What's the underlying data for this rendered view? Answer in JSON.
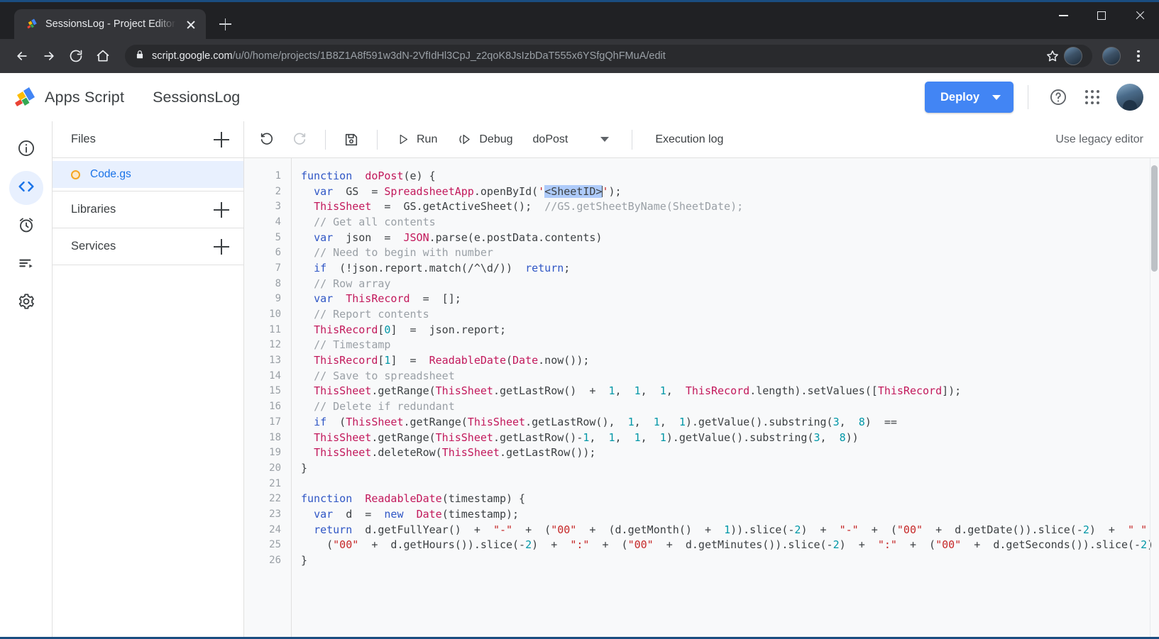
{
  "browser": {
    "tab": {
      "title": "SessionsLog - Project Editor - Ap",
      "favicon": "apps-script-favicon"
    },
    "new_tab_label": "+",
    "url_domain": "script.google.com",
    "url_path": "/u/0/home/projects/1B8Z1A8f591w3dN-2VfIdHl3CpJ_z2qoK8JsIzbDaT555x6YSfgQhFMuA/edit",
    "window_controls": {
      "minimize": "minimize-icon",
      "maximize": "maximize-icon",
      "close": "close-icon"
    }
  },
  "appbar": {
    "brand": "Apps Script",
    "project_name": "SessionsLog",
    "deploy_label": "Deploy",
    "help_icon": "help-icon",
    "apps_icon": "apps-grid-icon",
    "avatar": "user-avatar"
  },
  "rail": {
    "items": [
      {
        "name": "overview",
        "icon": "info-circle-icon",
        "active": false
      },
      {
        "name": "editor",
        "icon": "code-brackets-icon",
        "active": true
      },
      {
        "name": "triggers",
        "icon": "alarm-clock-icon",
        "active": false
      },
      {
        "name": "executions",
        "icon": "executions-list-icon",
        "active": false
      },
      {
        "name": "settings",
        "icon": "gear-icon",
        "active": false
      }
    ]
  },
  "files_panel": {
    "files_header": "Files",
    "libraries_header": "Libraries",
    "services_header": "Services",
    "files": [
      {
        "name": "Code.gs",
        "selected": true,
        "status_dot": "unsaved-orange"
      }
    ]
  },
  "editor_toolbar": {
    "undo": "undo-icon",
    "redo": "redo-icon",
    "save": "save-icon",
    "run_label": "Run",
    "debug_label": "Debug",
    "function_selected": "doPost",
    "execution_log_label": "Execution log",
    "legacy_editor_label": "Use legacy editor"
  },
  "code": {
    "selection_text": "<SheetID>",
    "lines": [
      {
        "n": 1,
        "tokens": [
          [
            "kw",
            "function"
          ],
          [
            "",
            "  "
          ],
          [
            "id",
            "doPost"
          ],
          [
            "",
            "(e) {"
          ]
        ]
      },
      {
        "n": 2,
        "tokens": [
          [
            "",
            "  "
          ],
          [
            "kw",
            "var"
          ],
          [
            "",
            "  GS  = "
          ],
          [
            "id",
            "SpreadsheetApp"
          ],
          [
            "",
            ".openById("
          ],
          [
            "str",
            "'"
          ],
          [
            "sel",
            "<SheetID>"
          ],
          [
            "cursor",
            ""
          ],
          [
            "str",
            "'"
          ],
          [
            "",
            ");"
          ]
        ]
      },
      {
        "n": 3,
        "tokens": [
          [
            "",
            "  "
          ],
          [
            "id",
            "ThisSheet"
          ],
          [
            "",
            "  =  GS"
          ],
          [
            "",
            ".getActiveSheet();  "
          ],
          [
            "cmt",
            "//GS.getSheetByName(SheetDate);"
          ]
        ]
      },
      {
        "n": 4,
        "tokens": [
          [
            "",
            "  "
          ],
          [
            "cmt",
            "// Get all contents"
          ]
        ]
      },
      {
        "n": 5,
        "tokens": [
          [
            "",
            "  "
          ],
          [
            "kw",
            "var"
          ],
          [
            "",
            "  json  =  "
          ],
          [
            "id",
            "JSON"
          ],
          [
            "",
            ".parse(e.postData.contents)"
          ]
        ]
      },
      {
        "n": 6,
        "tokens": [
          [
            "",
            "  "
          ],
          [
            "cmt",
            "// Need to begin with number"
          ]
        ]
      },
      {
        "n": 7,
        "tokens": [
          [
            "",
            "  "
          ],
          [
            "kw",
            "if"
          ],
          [
            "",
            "  (!json.report.match(/^\\d/))  "
          ],
          [
            "kw",
            "return"
          ],
          [
            "",
            ";"
          ]
        ]
      },
      {
        "n": 8,
        "tokens": [
          [
            "",
            "  "
          ],
          [
            "cmt",
            "// Row array"
          ]
        ]
      },
      {
        "n": 9,
        "tokens": [
          [
            "",
            "  "
          ],
          [
            "kw",
            "var"
          ],
          [
            "",
            "  "
          ],
          [
            "id",
            "ThisRecord"
          ],
          [
            "",
            "  =  [];"
          ]
        ]
      },
      {
        "n": 10,
        "tokens": [
          [
            "",
            "  "
          ],
          [
            "cmt",
            "// Report contents"
          ]
        ]
      },
      {
        "n": 11,
        "tokens": [
          [
            "",
            "  "
          ],
          [
            "id",
            "ThisRecord"
          ],
          [
            "",
            "["
          ],
          [
            "num",
            "0"
          ],
          [
            "",
            "]  =  json.report;"
          ]
        ]
      },
      {
        "n": 12,
        "tokens": [
          [
            "",
            "  "
          ],
          [
            "cmt",
            "// Timestamp"
          ]
        ]
      },
      {
        "n": 13,
        "tokens": [
          [
            "",
            "  "
          ],
          [
            "id",
            "ThisRecord"
          ],
          [
            "",
            "["
          ],
          [
            "num",
            "1"
          ],
          [
            "",
            "]  =  "
          ],
          [
            "id",
            "ReadableDate"
          ],
          [
            "",
            "("
          ],
          [
            "id",
            "Date"
          ],
          [
            "",
            ".now());"
          ]
        ]
      },
      {
        "n": 14,
        "tokens": [
          [
            "",
            "  "
          ],
          [
            "cmt",
            "// Save to spreadsheet"
          ]
        ]
      },
      {
        "n": 15,
        "tokens": [
          [
            "",
            "  "
          ],
          [
            "id",
            "ThisSheet"
          ],
          [
            "",
            ".getRange("
          ],
          [
            "id",
            "ThisSheet"
          ],
          [
            "",
            ".getLastRow()  +  "
          ],
          [
            "num",
            "1"
          ],
          [
            "",
            ",  "
          ],
          [
            "num",
            "1"
          ],
          [
            "",
            ",  "
          ],
          [
            "num",
            "1"
          ],
          [
            "",
            ",  "
          ],
          [
            "id",
            "ThisRecord"
          ],
          [
            "",
            ".length).setValues(["
          ],
          [
            "id",
            "ThisRecord"
          ],
          [
            "",
            "]);"
          ]
        ]
      },
      {
        "n": 16,
        "tokens": [
          [
            "",
            "  "
          ],
          [
            "cmt",
            "// Delete if redundant"
          ]
        ]
      },
      {
        "n": 17,
        "tokens": [
          [
            "",
            "  "
          ],
          [
            "kw",
            "if"
          ],
          [
            "",
            "  ("
          ],
          [
            "id",
            "ThisSheet"
          ],
          [
            "",
            ".getRange("
          ],
          [
            "id",
            "ThisSheet"
          ],
          [
            "",
            ".getLastRow(),  "
          ],
          [
            "num",
            "1"
          ],
          [
            "",
            ",  "
          ],
          [
            "num",
            "1"
          ],
          [
            "",
            ",  "
          ],
          [
            "num",
            "1"
          ],
          [
            "",
            ").getValue().substring("
          ],
          [
            "num",
            "3"
          ],
          [
            "",
            ",  "
          ],
          [
            "num",
            "8"
          ],
          [
            "",
            ")  =="
          ]
        ]
      },
      {
        "n": 18,
        "tokens": [
          [
            "",
            "  "
          ],
          [
            "id",
            "ThisSheet"
          ],
          [
            "",
            ".getRange("
          ],
          [
            "id",
            "ThisSheet"
          ],
          [
            "",
            ".getLastRow()-"
          ],
          [
            "num",
            "1"
          ],
          [
            "",
            ",  "
          ],
          [
            "num",
            "1"
          ],
          [
            "",
            ",  "
          ],
          [
            "num",
            "1"
          ],
          [
            "",
            ",  "
          ],
          [
            "num",
            "1"
          ],
          [
            "",
            ").getValue().substring("
          ],
          [
            "num",
            "3"
          ],
          [
            "",
            ",  "
          ],
          [
            "num",
            "8"
          ],
          [
            "",
            "))"
          ]
        ]
      },
      {
        "n": 19,
        "tokens": [
          [
            "",
            "  "
          ],
          [
            "id",
            "ThisSheet"
          ],
          [
            "",
            ".deleteRow("
          ],
          [
            "id",
            "ThisSheet"
          ],
          [
            "",
            ".getLastRow());"
          ]
        ]
      },
      {
        "n": 20,
        "tokens": [
          [
            "",
            "}"
          ]
        ]
      },
      {
        "n": 21,
        "tokens": [
          [
            "",
            ""
          ]
        ]
      },
      {
        "n": 22,
        "tokens": [
          [
            "kw",
            "function"
          ],
          [
            "",
            "  "
          ],
          [
            "id",
            "ReadableDate"
          ],
          [
            "",
            "(timestamp) {"
          ]
        ]
      },
      {
        "n": 23,
        "tokens": [
          [
            "",
            "  "
          ],
          [
            "kw",
            "var"
          ],
          [
            "",
            "  d  =  "
          ],
          [
            "kw",
            "new"
          ],
          [
            "",
            "  "
          ],
          [
            "id",
            "Date"
          ],
          [
            "",
            "(timestamp);"
          ]
        ]
      },
      {
        "n": 24,
        "tokens": [
          [
            "",
            "  "
          ],
          [
            "kw",
            "return"
          ],
          [
            "",
            "  d.getFullYear()  +  "
          ],
          [
            "str",
            "\"-\""
          ],
          [
            "",
            "  +  ("
          ],
          [
            "str",
            "\"00\""
          ],
          [
            "",
            "  +  (d.getMonth()  +  "
          ],
          [
            "num",
            "1"
          ],
          [
            "",
            ")).slice(-"
          ],
          [
            "num",
            "2"
          ],
          [
            "",
            ")  +  "
          ],
          [
            "str",
            "\"-\""
          ],
          [
            "",
            "  +  ("
          ],
          [
            "str",
            "\"00\""
          ],
          [
            "",
            "  +  d.getDate()).slice(-"
          ],
          [
            "num",
            "2"
          ],
          [
            "",
            ")  +  "
          ],
          [
            "str",
            "\" \""
          ],
          [
            "",
            "  +"
          ]
        ]
      },
      {
        "n": 25,
        "tokens": [
          [
            "",
            "    ("
          ],
          [
            "str",
            "\"00\""
          ],
          [
            "",
            "  +  d.getHours()).slice(-"
          ],
          [
            "num",
            "2"
          ],
          [
            "",
            ")  +  "
          ],
          [
            "str",
            "\":\""
          ],
          [
            "",
            "  +  ("
          ],
          [
            "str",
            "\"00\""
          ],
          [
            "",
            "  +  d.getMinutes()).slice(-"
          ],
          [
            "num",
            "2"
          ],
          [
            "",
            ")  +  "
          ],
          [
            "str",
            "\":\""
          ],
          [
            "",
            "  +  ("
          ],
          [
            "str",
            "\"00\""
          ],
          [
            "",
            "  +  d.getSeconds()).slice(-"
          ],
          [
            "num",
            "2"
          ],
          [
            "",
            ");"
          ]
        ]
      },
      {
        "n": 26,
        "tokens": [
          [
            "",
            "}"
          ]
        ]
      }
    ]
  },
  "colors": {
    "accent_blue": "#4285f4",
    "link_blue": "#1a73e8",
    "selection_blue": "#aecbfa",
    "keyword": "#2f56c5",
    "identifier": "#c2185b",
    "number": "#0097a7",
    "string": "#c62828",
    "comment": "#9aa0a6",
    "file_dot_orange": "#f5a623"
  }
}
